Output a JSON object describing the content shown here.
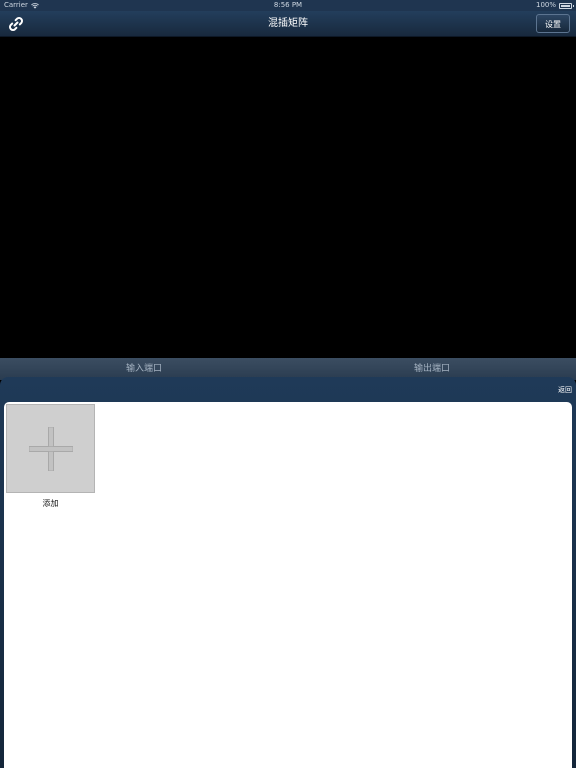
{
  "status_bar": {
    "carrier": "Carrier",
    "time": "8:56 PM",
    "battery": "100%"
  },
  "nav": {
    "title": "混插矩阵",
    "settings_label": "设置",
    "left_icon": "link-icon"
  },
  "port_tabs": {
    "input_label": "输入端口",
    "output_label": "输出端口"
  },
  "panel": {
    "back_label": "返回",
    "add_label": "添加",
    "add_icon": "plus-icon"
  },
  "colors": {
    "nav_bar": "#1f3550",
    "panel": "#1f3a58",
    "tile": "#cfcfcf"
  }
}
